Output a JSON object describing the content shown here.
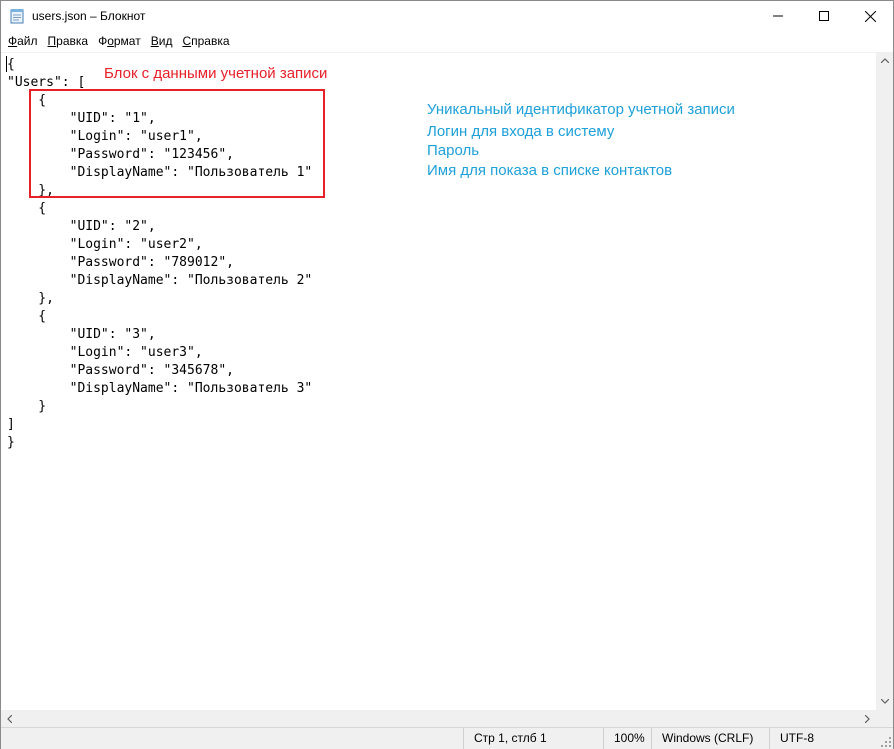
{
  "window": {
    "title": "users.json – Блокнот",
    "icon": "notepad-icon"
  },
  "menu": [
    {
      "first": "Ф",
      "rest": "айл"
    },
    {
      "first": "П",
      "rest": "равка"
    },
    {
      "first": "",
      "rest": "Формат",
      "acc_index": 1
    },
    {
      "first": "В",
      "rest": "ид"
    },
    {
      "first": "С",
      "rest": "правка"
    }
  ],
  "menu_labels": {
    "file": "Файл",
    "edit": "Правка",
    "format": "Формат",
    "view": "Вид",
    "help": "Справка"
  },
  "editor": {
    "lines": [
      "{",
      "\"Users\": [",
      "    {",
      "        \"UID\": \"1\",",
      "        \"Login\": \"user1\",",
      "        \"Password\": \"123456\",",
      "        \"DisplayName\": \"Пользователь 1\"",
      "    },",
      "    {",
      "        \"UID\": \"2\",",
      "        \"Login\": \"user2\",",
      "        \"Password\": \"789012\",",
      "        \"DisplayName\": \"Пользователь 2\"",
      "    },",
      "    {",
      "        \"UID\": \"3\",",
      "        \"Login\": \"user3\",",
      "        \"Password\": \"345678\",",
      "        \"DisplayName\": \"Пользователь 3\"",
      "    }",
      "]",
      "}"
    ]
  },
  "annotations": {
    "block_label": "Блок с данными учетной записи",
    "uid": "Уникальный идентификатор учетной записи",
    "login": "Логин для входа в систему",
    "password": "Пароль",
    "display_name": "Имя для показа в списке контактов",
    "red_color": "#e8202a",
    "blue_color": "#1ea0d8"
  },
  "status": {
    "position": "Стр 1, стлб 1",
    "zoom": "100%",
    "line_endings": "Windows (CRLF)",
    "encoding": "UTF-8"
  }
}
